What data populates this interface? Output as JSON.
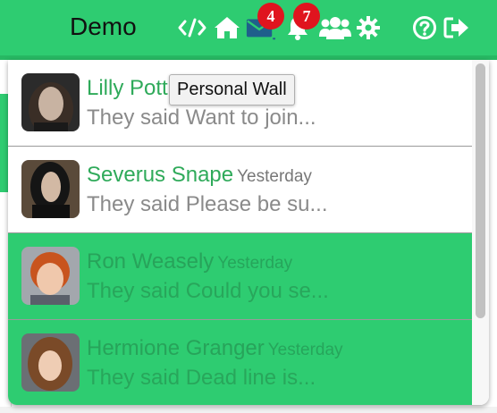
{
  "navbar": {
    "brand": "Demo",
    "icons": {
      "code": "code-icon",
      "home": "home-icon",
      "messages": "envelope-icon",
      "notifications": "bell-icon",
      "users": "users-icon",
      "settings": "gear-icon",
      "help": "question-circle-icon",
      "logout": "sign-out-icon"
    },
    "messages_badge": "4",
    "notifications_badge": "7"
  },
  "tooltip": "Personal Wall",
  "messages": [
    {
      "name": "Lilly Pott",
      "time": "",
      "preview": "They said Want to join...",
      "active": false
    },
    {
      "name": "Severus Snape",
      "time": "Yesterday",
      "preview": "They said Please be su...",
      "active": false
    },
    {
      "name": "Ron Weasely",
      "time": "Yesterday",
      "preview": "They said Could you se...",
      "active": true
    },
    {
      "name": "Hermione Granger",
      "time": "Yesterday",
      "preview": "They said Dead line is...",
      "active": true
    }
  ],
  "colors": {
    "navbar": "#2ecc71",
    "accent": "#2faa5a",
    "badge": "#e0141e",
    "envelope": "#1f5f8b"
  }
}
